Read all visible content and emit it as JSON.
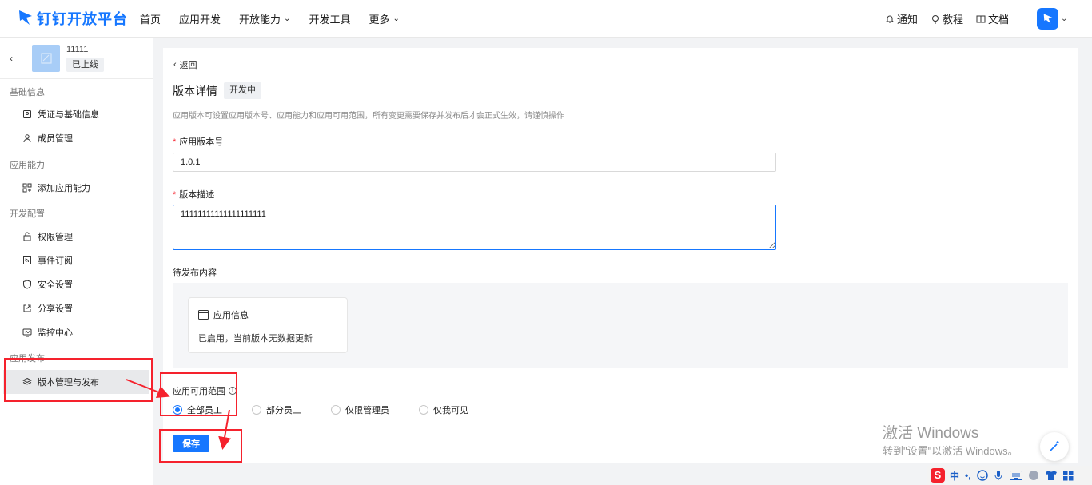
{
  "brand": {
    "name": "钉钉开放平台",
    "color": "#1677ff"
  },
  "nav": {
    "items": [
      {
        "label": "首页",
        "has_dropdown": false
      },
      {
        "label": "应用开发",
        "has_dropdown": false
      },
      {
        "label": "开放能力",
        "has_dropdown": true
      },
      {
        "label": "开发工具",
        "has_dropdown": false
      },
      {
        "label": "更多",
        "has_dropdown": true
      }
    ],
    "right": [
      {
        "label": "通知",
        "icon": "bell-icon"
      },
      {
        "label": "教程",
        "icon": "lightbulb-icon"
      },
      {
        "label": "文档",
        "icon": "book-icon"
      }
    ]
  },
  "sidebar": {
    "app_name": "11111",
    "app_status": "已上线",
    "groups": [
      {
        "label": "基础信息",
        "items": [
          {
            "label": "凭证与基础信息",
            "icon": "credential-icon"
          },
          {
            "label": "成员管理",
            "icon": "user-icon"
          }
        ]
      },
      {
        "label": "应用能力",
        "items": [
          {
            "label": "添加应用能力",
            "icon": "grid-add-icon"
          }
        ]
      },
      {
        "label": "开发配置",
        "items": [
          {
            "label": "权限管理",
            "icon": "lock-icon"
          },
          {
            "label": "事件订阅",
            "icon": "subscribe-icon"
          },
          {
            "label": "安全设置",
            "icon": "shield-icon"
          },
          {
            "label": "分享设置",
            "icon": "share-icon"
          },
          {
            "label": "监控中心",
            "icon": "monitor-icon"
          }
        ]
      },
      {
        "label": "应用发布",
        "items": [
          {
            "label": "版本管理与发布",
            "icon": "layers-icon",
            "active": true
          }
        ]
      }
    ]
  },
  "main": {
    "back_label": "返回",
    "title": "版本详情",
    "status_tag": "开发中",
    "description": "应用版本可设置应用版本号、应用能力和应用可用范围，所有变更需要保存并发布后才会正式生效，请谨慎操作",
    "version_label": "应用版本号",
    "version_value": "1.0.1",
    "desc_label": "版本描述",
    "desc_value": "11111111111111111111",
    "pending_label": "待发布内容",
    "card_title": "应用信息",
    "card_body": "已启用，当前版本无数据更新",
    "scope_label": "应用可用范围",
    "scope_options": [
      {
        "label": "全部员工",
        "selected": true
      },
      {
        "label": "部分员工",
        "selected": false
      },
      {
        "label": "仅限管理员",
        "selected": false
      },
      {
        "label": "仅我可见",
        "selected": false
      }
    ],
    "save_label": "保存"
  },
  "watermark": {
    "line1": "激活 Windows",
    "line2": "转到\"设置\"以激活 Windows。"
  },
  "ime": {
    "lang": "中",
    "punct": "•,"
  }
}
